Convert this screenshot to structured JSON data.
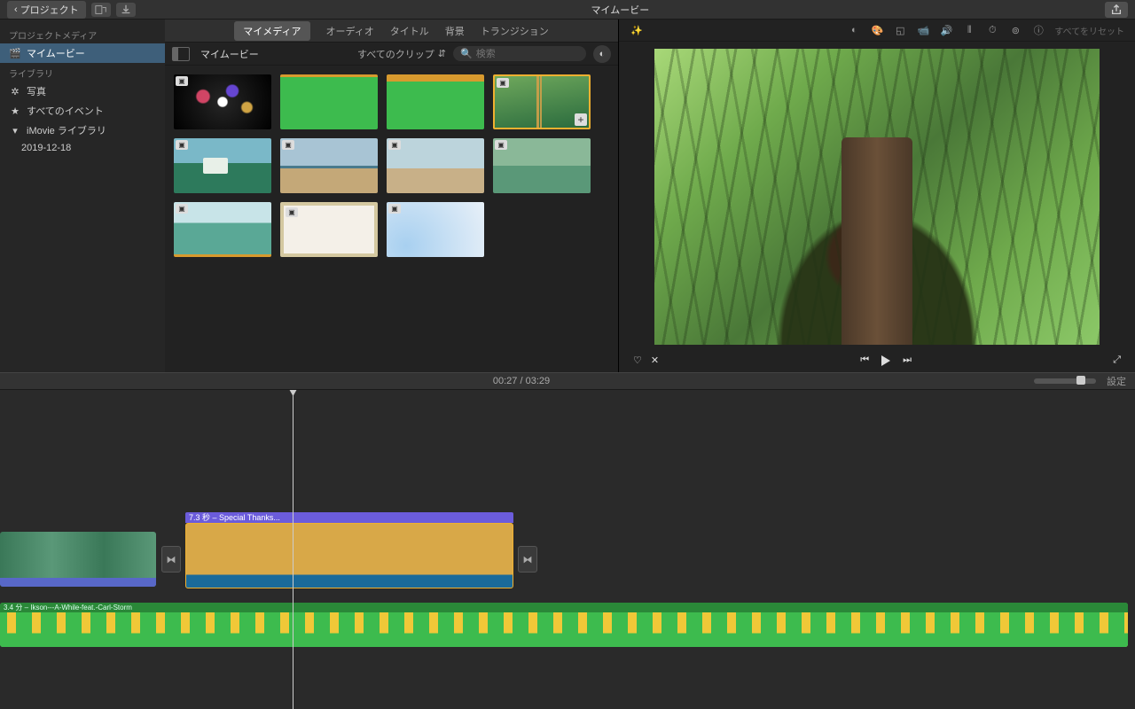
{
  "titlebar": {
    "back": "プロジェクト",
    "title": "マイムービー"
  },
  "sidebar": {
    "header1": "プロジェクトメディア",
    "project": "マイムービー",
    "header2": "ライブラリ",
    "photos": "写真",
    "allEvents": "すべてのイベント",
    "library": "iMovie ライブラリ",
    "date": "2019-12-18"
  },
  "browser": {
    "tabs": [
      "マイメディア",
      "オーディオ",
      "タイトル",
      "背景",
      "トランジション"
    ],
    "crumb": "マイムービー",
    "filter": "すべてのクリップ",
    "searchPlaceholder": "検索"
  },
  "viewer": {
    "resetAll": "すべてをリセット"
  },
  "timeline": {
    "current": "00:27",
    "total": "03:29",
    "settings": "設定",
    "titleClip": "7.3 秒 – Special Thanks...",
    "audioClip": "3.4 分 – Ikson---A-While-feat.-Carl-Storm"
  }
}
